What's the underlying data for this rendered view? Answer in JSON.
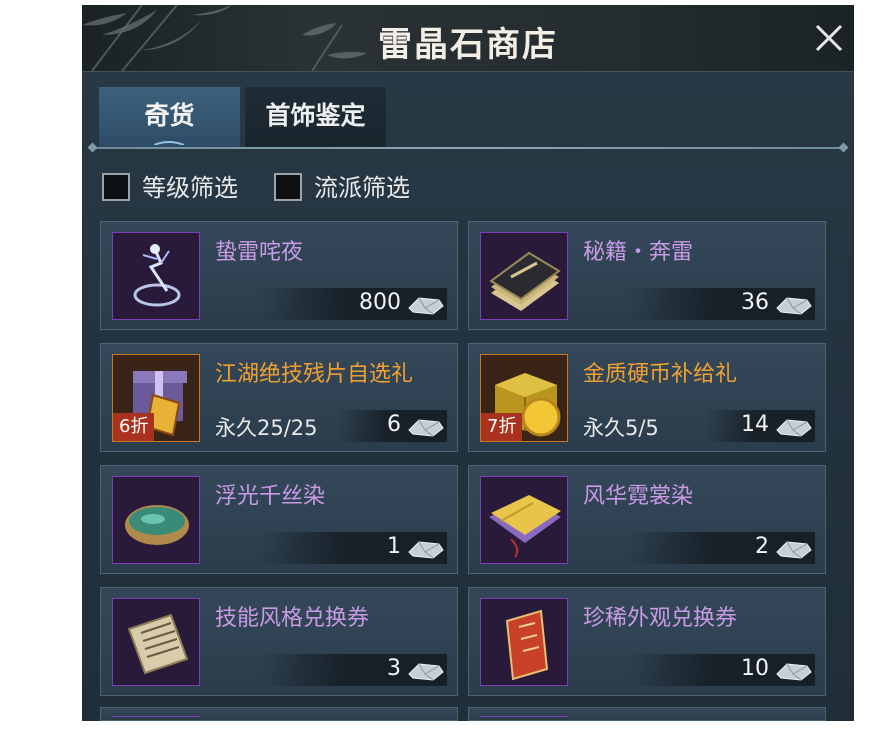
{
  "window": {
    "title": "雷晶石商店",
    "close_icon": "close-icon"
  },
  "tabs": [
    {
      "label": "奇货",
      "active": true
    },
    {
      "label": "首饰鉴定",
      "active": false
    }
  ],
  "filters": [
    {
      "label": "等级筛选",
      "checked": false
    },
    {
      "label": "流派筛选",
      "checked": false
    }
  ],
  "currency_icon": "lightning-crystal-icon",
  "items": [
    {
      "name": "蛰雷咤夜",
      "price": "800",
      "limit": "",
      "discount": "",
      "rarity": "purple",
      "icon": "lightning-spirit-icon"
    },
    {
      "name": "秘籍・奔雷",
      "price": "36",
      "limit": "",
      "discount": "",
      "rarity": "purple",
      "icon": "skill-book-icon"
    },
    {
      "name": "江湖绝技残片自选礼",
      "price": "6",
      "limit": "永久25/25",
      "discount": "6折",
      "rarity": "gold",
      "icon": "gift-box-icon"
    },
    {
      "name": "金质硬币补给礼",
      "price": "14",
      "limit": "永久5/5",
      "discount": "7折",
      "rarity": "gold",
      "icon": "coin-chest-icon"
    },
    {
      "name": "浮光千丝染",
      "price": "1",
      "limit": "",
      "discount": "",
      "rarity": "purple",
      "icon": "dye-bowl-icon"
    },
    {
      "name": "风华霓裳染",
      "price": "2",
      "limit": "",
      "discount": "",
      "rarity": "purple",
      "icon": "fabric-dye-icon"
    },
    {
      "name": "技能风格兑换券",
      "price": "3",
      "limit": "",
      "discount": "",
      "rarity": "purple",
      "icon": "scroll-voucher-icon"
    },
    {
      "name": "珍稀外观兑换券",
      "price": "10",
      "limit": "",
      "discount": "",
      "rarity": "purple",
      "icon": "red-voucher-icon"
    }
  ]
}
